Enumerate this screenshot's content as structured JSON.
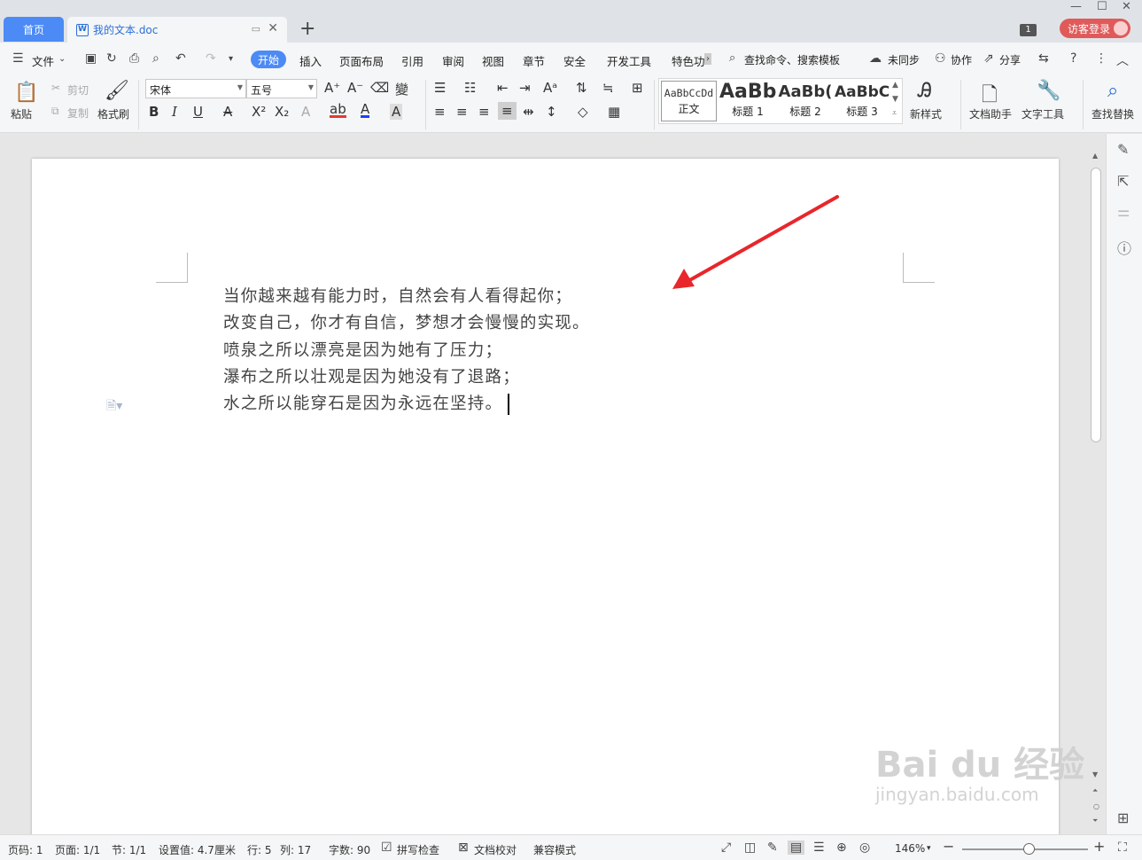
{
  "tabs": {
    "home": "首页",
    "document": "我的文本.doc",
    "doc_icon": "W"
  },
  "window": {
    "badge": "1",
    "login": "访客登录"
  },
  "menu": {
    "file": "文件",
    "start": "开始",
    "items": [
      "插入",
      "页面布局",
      "引用",
      "审阅",
      "视图",
      "章节",
      "安全",
      "开发工具",
      "特色功"
    ],
    "search": "查找命令、搜索模板",
    "sync": "未同步",
    "collab": "协作",
    "share": "分享"
  },
  "ribbon": {
    "paste": "粘贴",
    "cut": "剪切",
    "copy": "复制",
    "format_painter": "格式刷",
    "font_name": "宋体",
    "font_size": "五号",
    "styles": {
      "normal_preview": "AaBbCcDd",
      "normal_label": "正文",
      "h1_preview": "AaBb",
      "h1_label": "标题 1",
      "h2_preview": "AaBb(",
      "h2_label": "标题 2",
      "h3_preview": "AaBbC(",
      "h3_label": "标题 3"
    },
    "new_style": "新样式",
    "doc_assistant": "文档助手",
    "text_tools": "文字工具",
    "find_replace": "查找替换"
  },
  "document": {
    "lines": [
      "当你越来越有能力时，自然会有人看得起你；",
      "改变自己，你才有自信，梦想才会慢慢的实现。",
      "喷泉之所以漂亮是因为她有了压力；",
      "瀑布之所以壮观是因为她没有了退路；",
      "水之所以能穿石是因为永远在坚持。"
    ]
  },
  "watermark": {
    "main": "Bai du 经验",
    "sub": "jingyan.baidu.com"
  },
  "status": {
    "page_code": "页码: 1",
    "pages": "页面: 1/1",
    "section": "节: 1/1",
    "setting": "设置值: 4.7厘米",
    "row": "行: 5",
    "col": "列: 17",
    "word_count": "字数: 90",
    "spell_check": "拼写检查",
    "proofread": "文档校对",
    "compat": "兼容模式",
    "zoom": "146%"
  },
  "colors": {
    "accent": "#4c8bf5",
    "login": "#e05a5a",
    "arrow": "#e8262b"
  },
  "zoom_level": 1.46
}
